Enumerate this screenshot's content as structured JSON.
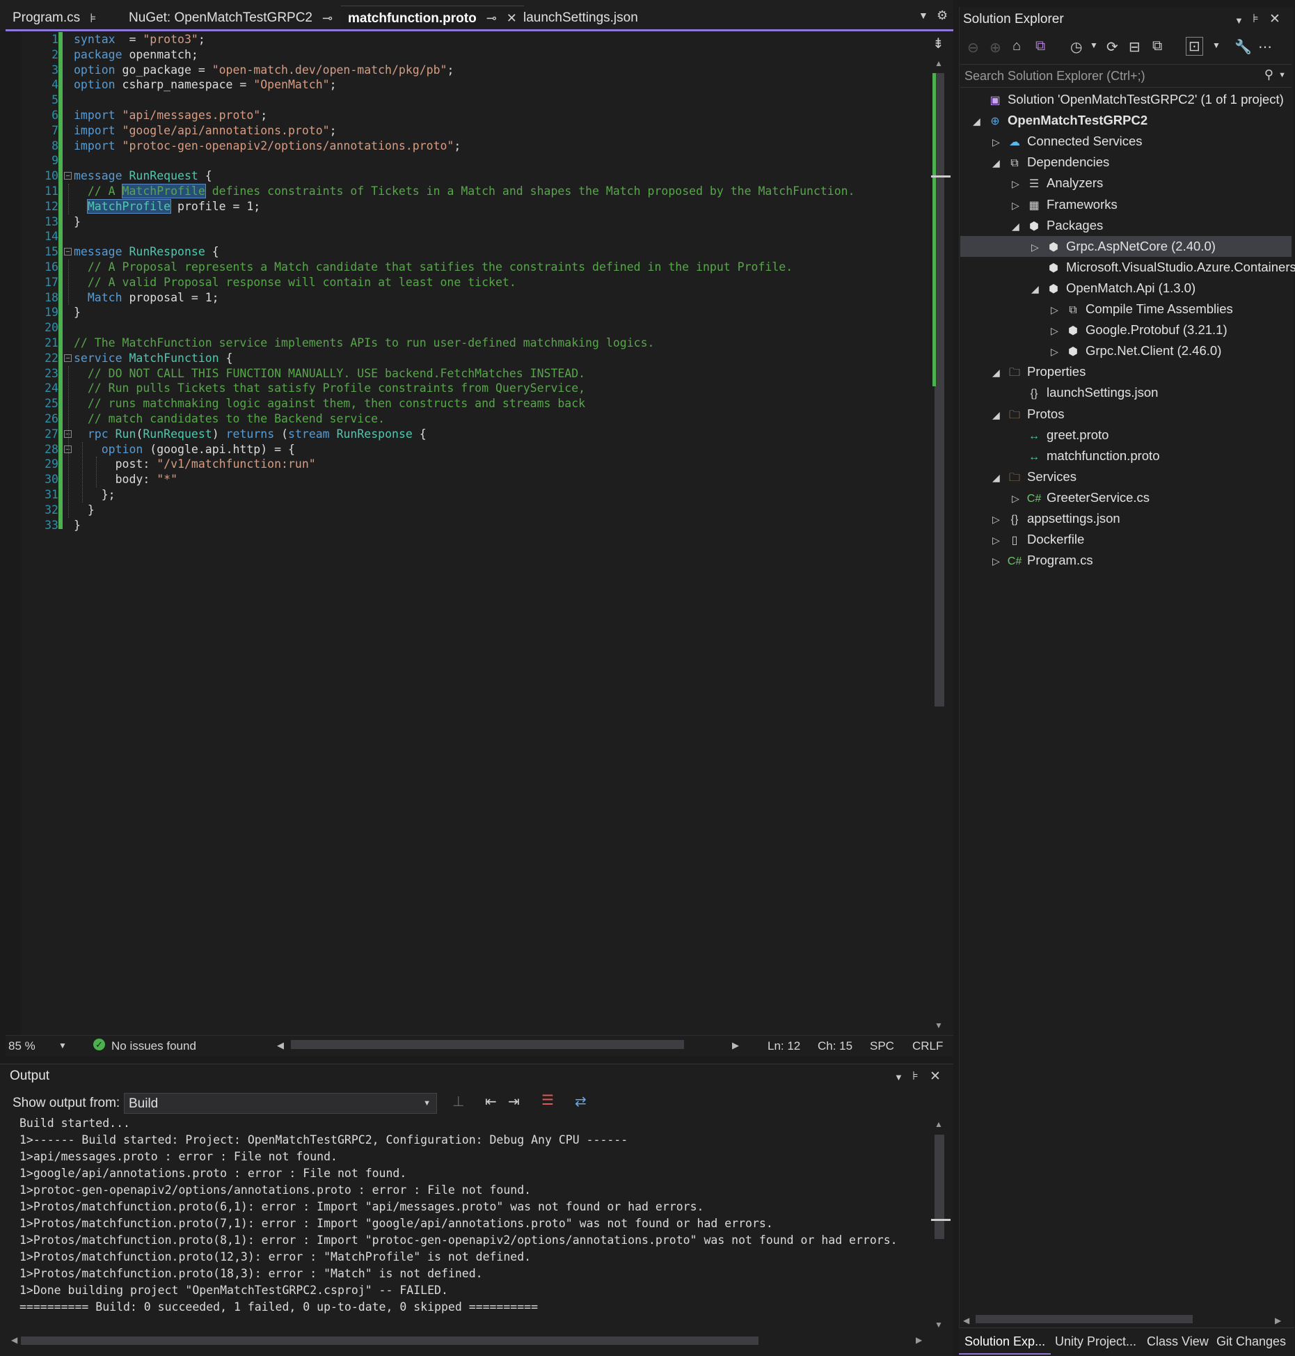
{
  "tabs": [
    {
      "label": "Program.cs",
      "pin": "pin-icon",
      "active": false
    },
    {
      "label": "NuGet: OpenMatchTestGRPC2",
      "pin": "pin-icon",
      "close": "close-icon",
      "active": false
    },
    {
      "label": "matchfunction.proto",
      "pin": "pin-icon",
      "close": "close-icon",
      "active": true
    },
    {
      "label": "launchSettings.json",
      "active": false
    }
  ],
  "editor": {
    "lines": [
      [
        [
          "kw",
          "syntax"
        ],
        [
          "",
          "  = "
        ],
        [
          "str",
          "\"proto3\""
        ],
        [
          "",
          ";"
        ]
      ],
      [
        [
          "kw",
          "package"
        ],
        [
          "",
          " openmatch;"
        ]
      ],
      [
        [
          "kw",
          "option"
        ],
        [
          "",
          " go_package = "
        ],
        [
          "str",
          "\"open-match.dev/open-match/pkg/pb\""
        ],
        [
          "",
          ";"
        ]
      ],
      [
        [
          "kw",
          "option"
        ],
        [
          "",
          " csharp_namespace = "
        ],
        [
          "str",
          "\"OpenMatch\""
        ],
        [
          "",
          ";"
        ]
      ],
      [],
      [
        [
          "kw",
          "import"
        ],
        [
          "",
          " "
        ],
        [
          "str",
          "\"api/messages.proto\""
        ],
        [
          "",
          ";"
        ]
      ],
      [
        [
          "kw",
          "import"
        ],
        [
          "",
          " "
        ],
        [
          "str",
          "\"google/api/annotations.proto\""
        ],
        [
          "",
          ";"
        ]
      ],
      [
        [
          "kw",
          "import"
        ],
        [
          "",
          " "
        ],
        [
          "str",
          "\"protoc-gen-openapiv2/options/annotations.proto\""
        ],
        [
          "",
          ";"
        ]
      ],
      [],
      [
        [
          "kw",
          "message"
        ],
        [
          "",
          " "
        ],
        [
          "ty",
          "RunRequest"
        ],
        [
          "",
          " {"
        ]
      ],
      [
        [
          "",
          "  "
        ],
        [
          "cm",
          "// A "
        ],
        [
          "cmhl",
          "MatchProfile"
        ],
        [
          "cm",
          " defines constraints of Tickets in a Match and shapes the Match proposed by the MatchFunction."
        ]
      ],
      [
        [
          "",
          "  "
        ],
        [
          "tyhl",
          "MatchProfile"
        ],
        [
          "",
          " profile = 1;"
        ]
      ],
      [
        [
          "",
          "}"
        ]
      ],
      [],
      [
        [
          "kw",
          "message"
        ],
        [
          "",
          " "
        ],
        [
          "ty",
          "RunResponse"
        ],
        [
          "",
          " {"
        ]
      ],
      [
        [
          "",
          "  "
        ],
        [
          "cm",
          "// A Proposal represents a Match candidate that satifies the constraints defined in the input Profile."
        ]
      ],
      [
        [
          "",
          "  "
        ],
        [
          "cm",
          "// A valid Proposal response will contain at least one ticket."
        ]
      ],
      [
        [
          "",
          "  "
        ],
        [
          "kw",
          "Match"
        ],
        [
          "",
          " proposal = 1;"
        ]
      ],
      [
        [
          "",
          "}"
        ]
      ],
      [],
      [
        [
          "cm",
          "// The MatchFunction service implements APIs to run user-defined matchmaking logics."
        ]
      ],
      [
        [
          "kw",
          "service"
        ],
        [
          "",
          " "
        ],
        [
          "ty",
          "MatchFunction"
        ],
        [
          "",
          " {"
        ]
      ],
      [
        [
          "",
          "  "
        ],
        [
          "cm",
          "// DO NOT CALL THIS FUNCTION MANUALLY. USE backend.FetchMatches INSTEAD."
        ]
      ],
      [
        [
          "",
          "  "
        ],
        [
          "cm",
          "// Run pulls Tickets that satisfy Profile constraints from QueryService,"
        ]
      ],
      [
        [
          "",
          "  "
        ],
        [
          "cm",
          "// runs matchmaking logic against them, then constructs and streams back"
        ]
      ],
      [
        [
          "",
          "  "
        ],
        [
          "cm",
          "// match candidates to the Backend service."
        ]
      ],
      [
        [
          "",
          "  "
        ],
        [
          "kw",
          "rpc"
        ],
        [
          "",
          " "
        ],
        [
          "ty",
          "Run"
        ],
        [
          "",
          "("
        ],
        [
          "ty",
          "RunRequest"
        ],
        [
          "",
          ") "
        ],
        [
          "kw",
          "returns"
        ],
        [
          "",
          " ("
        ],
        [
          "kw",
          "stream"
        ],
        [
          "",
          " "
        ],
        [
          "ty",
          "RunResponse"
        ],
        [
          "",
          " {"
        ]
      ],
      [
        [
          "",
          "    "
        ],
        [
          "kw",
          "option"
        ],
        [
          "",
          " (google.api.http) = {"
        ]
      ],
      [
        [
          "",
          "      post: "
        ],
        [
          "str",
          "\"/v1/matchfunction:run\""
        ]
      ],
      [
        [
          "",
          "      body: "
        ],
        [
          "str",
          "\"*\""
        ]
      ],
      [
        [
          "",
          "    };"
        ]
      ],
      [
        [
          "",
          "  }"
        ]
      ],
      [
        [
          "",
          "}"
        ]
      ]
    ]
  },
  "status": {
    "zoom": "85 %",
    "issues": "No issues found",
    "line": "Ln: 12",
    "col": "Ch: 15",
    "spacing": "SPC",
    "eol": "CRLF"
  },
  "output": {
    "title": "Output",
    "show_from_label": "Show output from:",
    "source": "Build",
    "lines": [
      "Build started...",
      "1>------ Build started: Project: OpenMatchTestGRPC2, Configuration: Debug Any CPU ------",
      "1>api/messages.proto : error : File not found.",
      "1>google/api/annotations.proto : error : File not found.",
      "1>protoc-gen-openapiv2/options/annotations.proto : error : File not found.",
      "1>Protos/matchfunction.proto(6,1): error : Import \"api/messages.proto\" was not found or had errors.",
      "1>Protos/matchfunction.proto(7,1): error : Import \"google/api/annotations.proto\" was not found or had errors.",
      "1>Protos/matchfunction.proto(8,1): error : Import \"protoc-gen-openapiv2/options/annotations.proto\" was not found or had errors.",
      "1>Protos/matchfunction.proto(12,3): error : \"MatchProfile\" is not defined.",
      "1>Protos/matchfunction.proto(18,3): error : \"Match\" is not defined.",
      "1>Done building project \"OpenMatchTestGRPC2.csproj\" -- FAILED.",
      "========== Build: 0 succeeded, 1 failed, 0 up-to-date, 0 skipped =========="
    ]
  },
  "solution_explorer": {
    "title": "Solution Explorer",
    "search_placeholder": "Search Solution Explorer (Ctrl+;)",
    "tree": [
      {
        "label": "Solution 'OpenMatchTestGRPC2' (1 of 1 project)",
        "depth": 0,
        "arrow": "",
        "icon": "solution-icon",
        "glyph": "▣",
        "color": "#c8a0ff"
      },
      {
        "label": "OpenMatchTestGRPC2",
        "depth": 0,
        "arrow": "◢",
        "icon": "project-icon",
        "glyph": "⊕",
        "color": "#4fa8e8",
        "bold": true
      },
      {
        "label": "Connected Services",
        "depth": 1,
        "arrow": "▷",
        "icon": "connected-services-icon",
        "glyph": "☁",
        "color": "#5fb7e8"
      },
      {
        "label": "Dependencies",
        "depth": 1,
        "arrow": "◢",
        "icon": "dependencies-icon",
        "glyph": "⧉",
        "color": "#d0d0d0"
      },
      {
        "label": "Analyzers",
        "depth": 2,
        "arrow": "▷",
        "icon": "analyzers-icon",
        "glyph": "☰",
        "color": "#d0d0d0"
      },
      {
        "label": "Frameworks",
        "depth": 2,
        "arrow": "▷",
        "icon": "frameworks-icon",
        "glyph": "▦",
        "color": "#d0d0d0"
      },
      {
        "label": "Packages",
        "depth": 2,
        "arrow": "◢",
        "icon": "packages-icon",
        "glyph": "⬢",
        "color": "#e0e0e0"
      },
      {
        "label": "Grpc.AspNetCore (2.40.0)",
        "depth": 3,
        "arrow": "▷",
        "icon": "package-icon",
        "glyph": "⬢",
        "color": "#e0e0e0",
        "selected": true
      },
      {
        "label": "Microsoft.VisualStudio.Azure.Containers.",
        "depth": 3,
        "arrow": "",
        "icon": "package-icon",
        "glyph": "⬢",
        "color": "#e0e0e0"
      },
      {
        "label": "OpenMatch.Api (1.3.0)",
        "depth": 3,
        "arrow": "◢",
        "icon": "package-icon",
        "glyph": "⬢",
        "color": "#e0e0e0"
      },
      {
        "label": "Compile Time Assemblies",
        "depth": 4,
        "arrow": "▷",
        "icon": "assemblies-icon",
        "glyph": "⧉",
        "color": "#d0d0d0"
      },
      {
        "label": "Google.Protobuf (3.21.1)",
        "depth": 4,
        "arrow": "▷",
        "icon": "package-icon",
        "glyph": "⬢",
        "color": "#e0e0e0"
      },
      {
        "label": "Grpc.Net.Client (2.46.0)",
        "depth": 4,
        "arrow": "▷",
        "icon": "package-icon",
        "glyph": "⬢",
        "color": "#e0e0e0"
      },
      {
        "label": "Properties",
        "depth": 1,
        "arrow": "◢",
        "icon": "properties-icon",
        "glyph": "🗀",
        "color": "#d0d0d0"
      },
      {
        "label": "launchSettings.json",
        "depth": 2,
        "arrow": "",
        "icon": "json-file-icon",
        "glyph": "{}",
        "color": "#d0d0d0"
      },
      {
        "label": "Protos",
        "depth": 1,
        "arrow": "◢",
        "icon": "folder-icon",
        "glyph": "🗀",
        "color": "#dcb67a"
      },
      {
        "label": "greet.proto",
        "depth": 2,
        "arrow": "",
        "icon": "proto-file-icon",
        "glyph": "↔",
        "color": "#4ec9b0"
      },
      {
        "label": "matchfunction.proto",
        "depth": 2,
        "arrow": "",
        "icon": "proto-file-icon",
        "glyph": "↔",
        "color": "#4ec9b0"
      },
      {
        "label": "Services",
        "depth": 1,
        "arrow": "◢",
        "icon": "folder-icon",
        "glyph": "🗀",
        "color": "#dcb67a"
      },
      {
        "label": "GreeterService.cs",
        "depth": 2,
        "arrow": "▷",
        "icon": "csharp-file-icon",
        "glyph": "C#",
        "color": "#6ec66e"
      },
      {
        "label": "appsettings.json",
        "depth": 1,
        "arrow": "▷",
        "icon": "json-file-icon",
        "glyph": "{}",
        "color": "#d0d0d0"
      },
      {
        "label": "Dockerfile",
        "depth": 1,
        "arrow": "▷",
        "icon": "file-icon",
        "glyph": "▯",
        "color": "#d0d0d0"
      },
      {
        "label": "Program.cs",
        "depth": 1,
        "arrow": "▷",
        "icon": "csharp-file-icon",
        "glyph": "C#",
        "color": "#6ec66e"
      }
    ],
    "bottom_tabs": [
      "Solution Exp...",
      "Unity Project...",
      "Class View",
      "Git Changes"
    ]
  }
}
